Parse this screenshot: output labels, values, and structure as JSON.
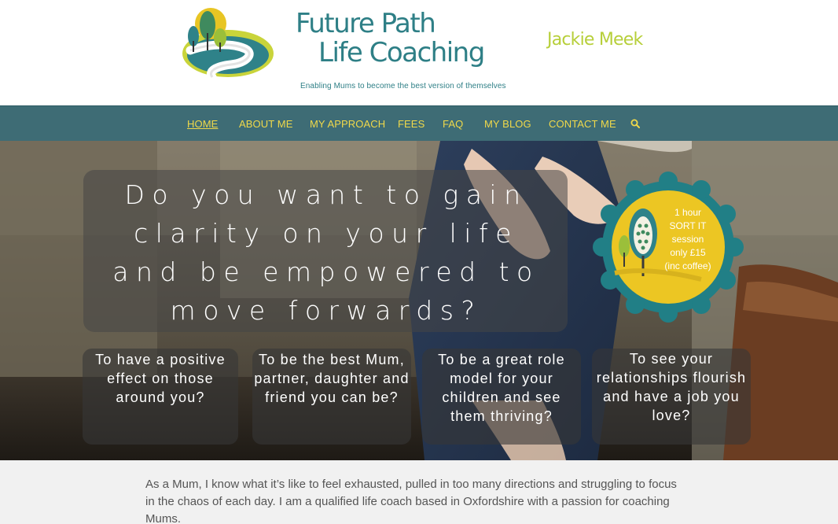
{
  "header": {
    "brand_line1": "Future Path",
    "brand_line2": "Life Coaching",
    "tagline": "Enabling Mums to become the best version of themselves",
    "author": "Jackie Meek"
  },
  "nav": {
    "items": [
      {
        "label": "HOME",
        "active": true
      },
      {
        "label": "ABOUT ME"
      },
      {
        "label": "MY APPROACH"
      },
      {
        "label": "FEES"
      },
      {
        "label": "FAQ"
      },
      {
        "label": "MY BLOG"
      },
      {
        "label": "CONTACT ME"
      }
    ],
    "search_icon": "search-icon"
  },
  "hero": {
    "headline": "Do you want to gain clarity on your life and be empowered to move forwards?",
    "badge": {
      "line1": "1 hour",
      "line2": "SORT IT",
      "line3": "session",
      "line4": "only £15",
      "line5": "(inc coffee)"
    },
    "questions": [
      "To have a positive effect on those around you?",
      "To be the best Mum, partner, daughter and friend you can be?",
      "To be a great role model for your children and see them thriving?",
      "To see your relationships flourish and have a job you love?"
    ]
  },
  "intro": {
    "text": "As a Mum, I know what it’s like to feel exhausted, pulled in too many directions and struggling to focus in the chaos of each day. I am a qualified life coach based in Oxfordshire with a passion for coaching Mums."
  },
  "colors": {
    "teal": "#2e7f86",
    "nav_bg": "#3e6c75",
    "nav_text": "#f0d94a",
    "lime": "#b7cf3a",
    "badge_yellow": "#ecc623",
    "badge_teal": "#217f86"
  }
}
